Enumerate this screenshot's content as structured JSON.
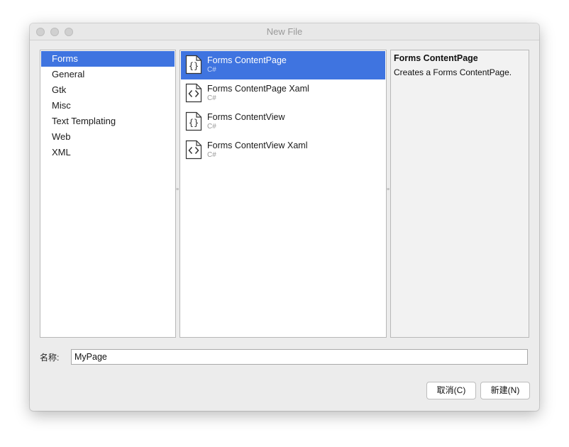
{
  "window": {
    "title": "New File"
  },
  "categories": [
    {
      "label": "Forms",
      "selected": true
    },
    {
      "label": "General",
      "selected": false
    },
    {
      "label": "Gtk",
      "selected": false
    },
    {
      "label": "Misc",
      "selected": false
    },
    {
      "label": "Text Templating",
      "selected": false
    },
    {
      "label": "Web",
      "selected": false
    },
    {
      "label": "XML",
      "selected": false
    }
  ],
  "templates": [
    {
      "name": "Forms ContentPage",
      "language": "C#",
      "icon": "code-file-icon",
      "selected": true
    },
    {
      "name": "Forms ContentPage Xaml",
      "language": "C#",
      "icon": "markup-file-icon",
      "selected": false
    },
    {
      "name": "Forms ContentView",
      "language": "C#",
      "icon": "code-file-icon",
      "selected": false
    },
    {
      "name": "Forms ContentView Xaml",
      "language": "C#",
      "icon": "markup-file-icon",
      "selected": false
    }
  ],
  "description": {
    "title": "Forms ContentPage",
    "text": "Creates a Forms ContentPage."
  },
  "name_field": {
    "label": "名称:",
    "value": "MyPage"
  },
  "buttons": {
    "cancel": "取消(C)",
    "new": "新建(N)"
  },
  "colors": {
    "selection": "#3f74e0"
  }
}
